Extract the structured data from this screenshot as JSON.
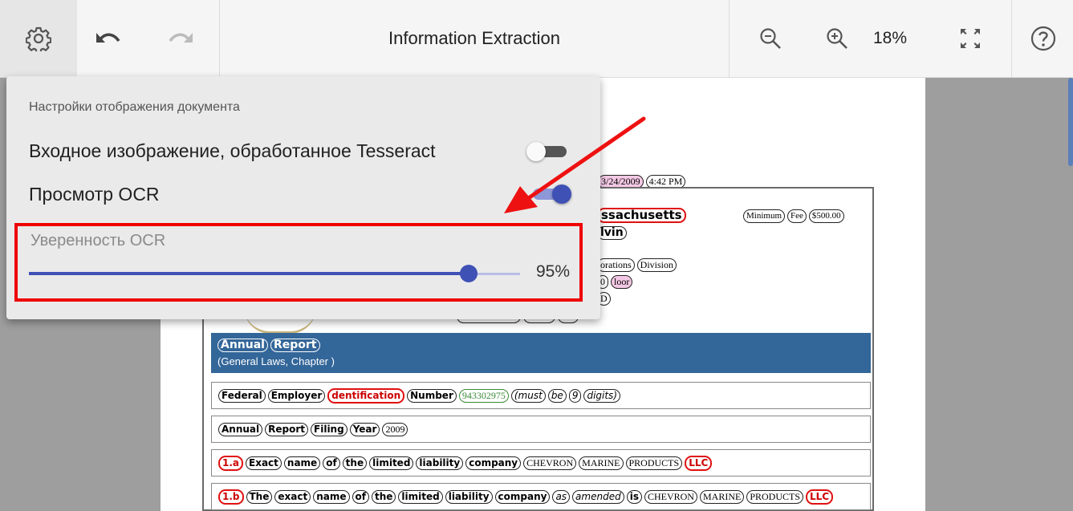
{
  "toolbar": {
    "title": "Information Extraction",
    "zoom_level": "18%",
    "icons": [
      "gear-icon",
      "undo-icon",
      "redo-icon",
      "zoom-out-icon",
      "zoom-in-icon",
      "fullscreen-icon",
      "help-icon"
    ]
  },
  "settings_panel": {
    "heading": "Настройки отображения документа",
    "option_tesseract": {
      "label": "Входное изображение, обработанное Tesseract",
      "enabled": false
    },
    "option_ocr_view": {
      "label": "Просмотр OCR",
      "enabled": true
    },
    "confidence": {
      "label": "Уверенность OCR",
      "value": 95,
      "value_text": "95%"
    }
  },
  "document": {
    "timestamp": {
      "date": "3/24/2009",
      "time": "4:42 PM"
    },
    "header_state": "ssachusetts",
    "header_name": "lvin",
    "fee": [
      "Minimum",
      "Fee",
      "$500.00"
    ],
    "corp_line": [
      "orations",
      "Division"
    ],
    "floor_line": [
      "0",
      "loor"
    ],
    "id_fragment": "D",
    "zip_fragment": "640",
    "banner_title": [
      "Annual",
      "Report"
    ],
    "banner_subtitle": "(General Laws, Chapter )",
    "row1": [
      "Federal",
      "Employer",
      "dentification",
      "Number",
      "943302975",
      "(must",
      "be",
      "9",
      "digits)"
    ],
    "row2": [
      "Annual",
      "Report",
      "Filing",
      "Year",
      "2009"
    ],
    "row3": [
      "1.a",
      "Exact",
      "name",
      "of",
      "the",
      "limited",
      "liability",
      "company",
      "CHEVRON",
      "MARINE",
      "PRODUCTS",
      "LLC"
    ],
    "row4": [
      "1.b",
      "The",
      "exact",
      "name",
      "of",
      "the",
      "limited",
      "liability",
      "company",
      "as",
      "amended",
      "is",
      "CHEVRON",
      "MARINE",
      "PRODUCTS",
      "LLC"
    ]
  },
  "colors": {
    "accent": "#3f51b5",
    "highlight": "#ee0000",
    "banner": "#336699",
    "arrow": "#ee1111"
  }
}
